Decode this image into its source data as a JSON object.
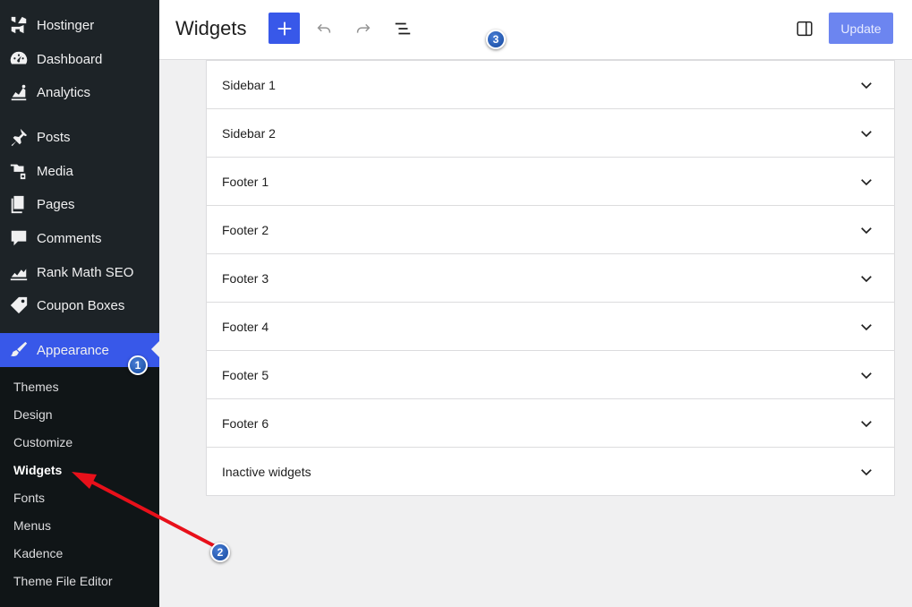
{
  "sidebar": {
    "items": [
      {
        "label": "Hostinger",
        "icon": "hostinger-logo-icon"
      },
      {
        "label": "Dashboard",
        "icon": "dashboard-gauge-icon"
      },
      {
        "label": "Analytics",
        "icon": "analytics-chart-icon"
      },
      {
        "label": "Posts",
        "icon": "pushpin-icon"
      },
      {
        "label": "Media",
        "icon": "media-camera-icon"
      },
      {
        "label": "Pages",
        "icon": "pages-icon"
      },
      {
        "label": "Comments",
        "icon": "comment-bubble-icon"
      },
      {
        "label": "Rank Math SEO",
        "icon": "rank-math-icon"
      },
      {
        "label": "Coupon Boxes",
        "icon": "tag-icon"
      },
      {
        "label": "Appearance",
        "icon": "paintbrush-icon"
      }
    ],
    "submenu": [
      "Themes",
      "Design",
      "Customize",
      "Widgets",
      "Fonts",
      "Menus",
      "Kadence",
      "Theme File Editor"
    ],
    "current_submenu": "Widgets"
  },
  "header": {
    "title": "Widgets",
    "update_label": "Update"
  },
  "panels": [
    "Sidebar 1",
    "Sidebar 2",
    "Footer 1",
    "Footer 2",
    "Footer 3",
    "Footer 4",
    "Footer 5",
    "Footer 6",
    "Inactive widgets"
  ],
  "markers": [
    "1",
    "2",
    "3"
  ],
  "colors": {
    "sidebar_bg": "#1d2327",
    "submenu_bg": "#101517",
    "accent": "#3858e9",
    "arrow": "#e8101a",
    "marker": "#1a5bb8"
  }
}
